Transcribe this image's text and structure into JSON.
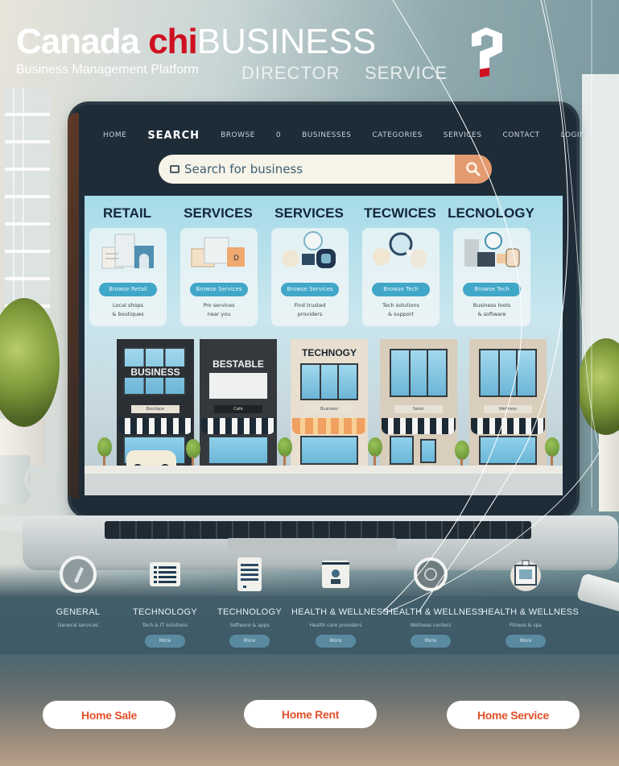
{
  "header": {
    "brand_word_1": "Canada",
    "brand_word_2": "chi",
    "brand_word_3": "BUSINESS",
    "subtitle": "Business Management Platform",
    "tag_1": "DIRECTOR",
    "tag_2": "SERVICE",
    "logo_icon": "question-mark-logo"
  },
  "colors": {
    "brand_red": "#cf1020",
    "search_accent": "#e49a6f",
    "card_button": "#41a7c8",
    "bottom_button_text": "#e0502a"
  },
  "laptop": {
    "nav": {
      "items": [
        {
          "label": "Home"
        },
        {
          "label": "SEARCH",
          "active": true
        },
        {
          "label": "Browse"
        },
        {
          "label": "0"
        },
        {
          "label": "Businesses"
        },
        {
          "label": "Categories"
        },
        {
          "label": "Services"
        },
        {
          "label": "Contact"
        },
        {
          "label": "Login"
        }
      ]
    },
    "search": {
      "placeholder": "Search for business",
      "button_icon": "search-icon"
    },
    "categories": [
      {
        "title": "RETAIL",
        "button": "Browse Retail",
        "text_1": "Local shops",
        "text_2": "& boutiques"
      },
      {
        "title": "SERVICES",
        "button": "Browse Services",
        "text_1": "Pro services",
        "text_2": "near you"
      },
      {
        "title": "SERVICES",
        "button": "Browse Services",
        "text_1": "Find trusted",
        "text_2": "providers"
      },
      {
        "title": "TECWICES",
        "button": "Browse Tech",
        "text_1": "Tech solutions",
        "text_2": "& support"
      },
      {
        "title": "LECNOLOGY",
        "button": "Browse Tech",
        "text_1": "Business tools",
        "text_2": "& software"
      }
    ],
    "storefronts": [
      {
        "sign": "BUSINESS",
        "plaque": "Boutique"
      },
      {
        "sign": "BESTABLE",
        "plaque": "Cafe"
      },
      {
        "sign": "TECHNOGY",
        "plaque": "Business"
      },
      {
        "sign": "",
        "plaque": "Salon"
      },
      {
        "sign": "",
        "plaque": "Wellness"
      }
    ]
  },
  "features": [
    {
      "title": "GENERAL",
      "desc": "General services",
      "button": "More",
      "icon": "general-icon"
    },
    {
      "title": "TECHNOLOGY",
      "desc": "Tech & IT solutions",
      "button": "More",
      "icon": "list-icon"
    },
    {
      "title": "TECHNOLOGY",
      "desc": "Software & apps",
      "button": "More",
      "icon": "document-icon"
    },
    {
      "title": "HEALTH & WELLNESS",
      "desc": "Health care providers",
      "button": "More",
      "icon": "person-icon"
    },
    {
      "title": "HEALTH & WELLNESS",
      "desc": "Wellness centers",
      "button": "More",
      "icon": "circle-icon"
    },
    {
      "title": "HEALTH & WELLNESS",
      "desc": "Fitness & spa",
      "button": "More",
      "icon": "clipboard-icon"
    }
  ],
  "bottom_buttons": [
    {
      "label": "Home Sale"
    },
    {
      "label": "Home Rent"
    },
    {
      "label": "Home Service"
    }
  ]
}
